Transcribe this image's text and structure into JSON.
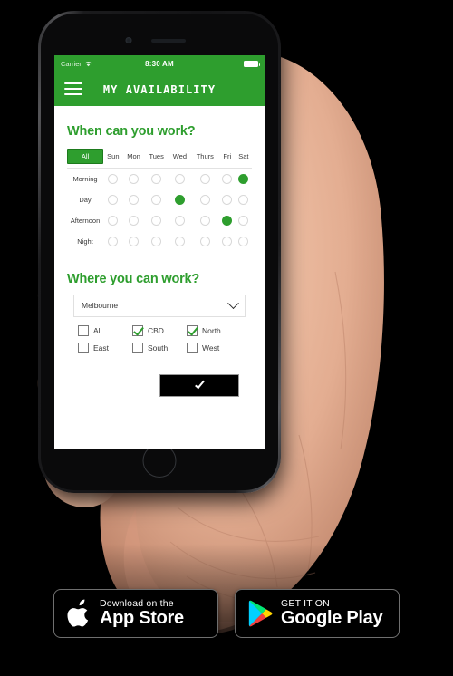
{
  "device": {
    "type": "smartphone-mockup",
    "frame_color": "#1b1b1d",
    "screen_bg": "#ffffff"
  },
  "theme": {
    "brand_green": "#2e9e2e",
    "brand_green_dark": "#1d7a1d",
    "text_dark": "#3b3b3b",
    "submit_bg": "#000000",
    "badge_bg": "#000000"
  },
  "statusbar": {
    "carrier": "Carrier",
    "wifi_icon": "wifi-icon",
    "time": "8:30 AM",
    "battery_icon": "battery-full-icon"
  },
  "navbar": {
    "menu_icon": "hamburger-menu-icon",
    "title": "MY AVAILABILITY"
  },
  "when_section": {
    "heading": "When can you work?",
    "all_tab": "All",
    "days": [
      "Sun",
      "Mon",
      "Tues",
      "Wed",
      "Thurs",
      "Fri",
      "Sat"
    ],
    "rows": [
      {
        "label": "Morning",
        "selected": [
          false,
          false,
          false,
          false,
          false,
          false,
          true
        ]
      },
      {
        "label": "Day",
        "selected": [
          false,
          false,
          false,
          true,
          false,
          false,
          false
        ]
      },
      {
        "label": "Afternoon",
        "selected": [
          false,
          false,
          false,
          false,
          false,
          true,
          false
        ]
      },
      {
        "label": "Night",
        "selected": [
          false,
          false,
          false,
          false,
          false,
          false,
          false
        ]
      }
    ]
  },
  "where_section": {
    "heading": "Where you can work?",
    "city_select": {
      "value": "Melbourne",
      "chevron_icon": "chevron-down-icon"
    },
    "areas": [
      {
        "label": "All",
        "checked": false
      },
      {
        "label": "CBD",
        "checked": true
      },
      {
        "label": "North",
        "checked": true
      },
      {
        "label": "East",
        "checked": false
      },
      {
        "label": "South",
        "checked": false
      },
      {
        "label": "West",
        "checked": false
      }
    ]
  },
  "submit_button": {
    "icon": "checkmark-icon",
    "label": ""
  },
  "store_badges": [
    {
      "id": "apple",
      "icon": "apple-logo-icon",
      "line1": "Download on the",
      "line2": "App Store"
    },
    {
      "id": "google",
      "icon": "google-play-icon",
      "line1": "GET IT ON",
      "line2": "Google Play"
    }
  ]
}
